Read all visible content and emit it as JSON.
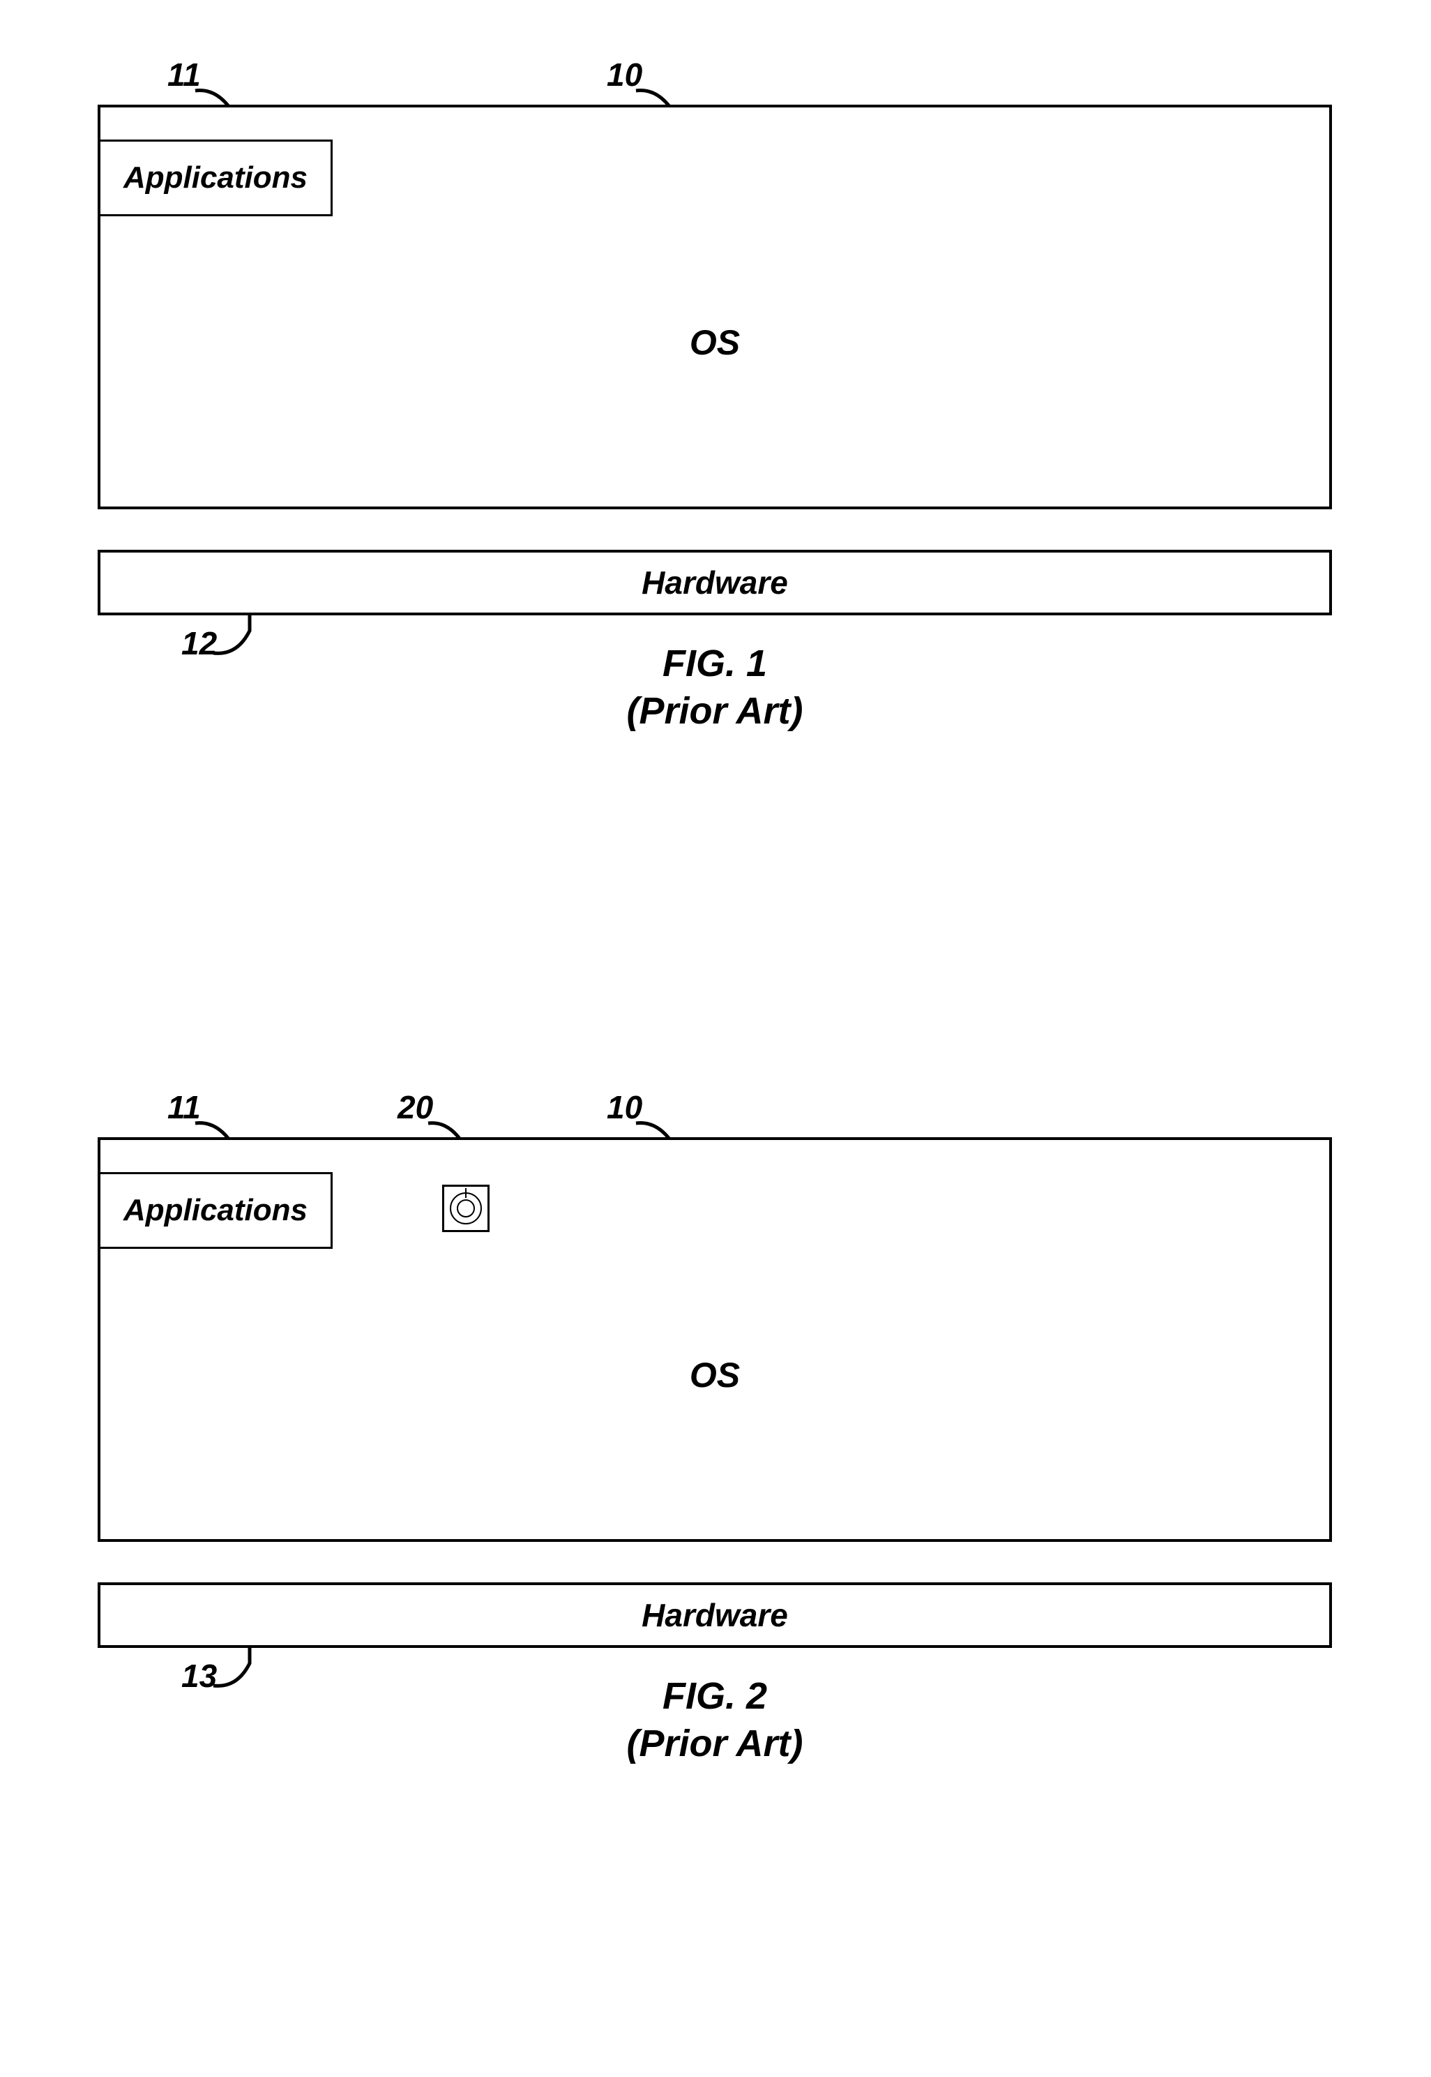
{
  "fig1": {
    "refs": {
      "applications": "11",
      "os": "10",
      "hardware": "12"
    },
    "blocks": {
      "applications": "Applications",
      "os": "OS",
      "hardware": "Hardware"
    },
    "caption_line1": "FIG. 1",
    "caption_line2": "(Prior Art)"
  },
  "fig2": {
    "refs": {
      "applications": "11",
      "bomb": "20",
      "os": "10",
      "hardware": "13"
    },
    "blocks": {
      "applications": "Applications",
      "os": "OS",
      "hardware": "Hardware"
    },
    "caption_line1": "FIG. 2",
    "caption_line2": "(Prior Art)"
  }
}
